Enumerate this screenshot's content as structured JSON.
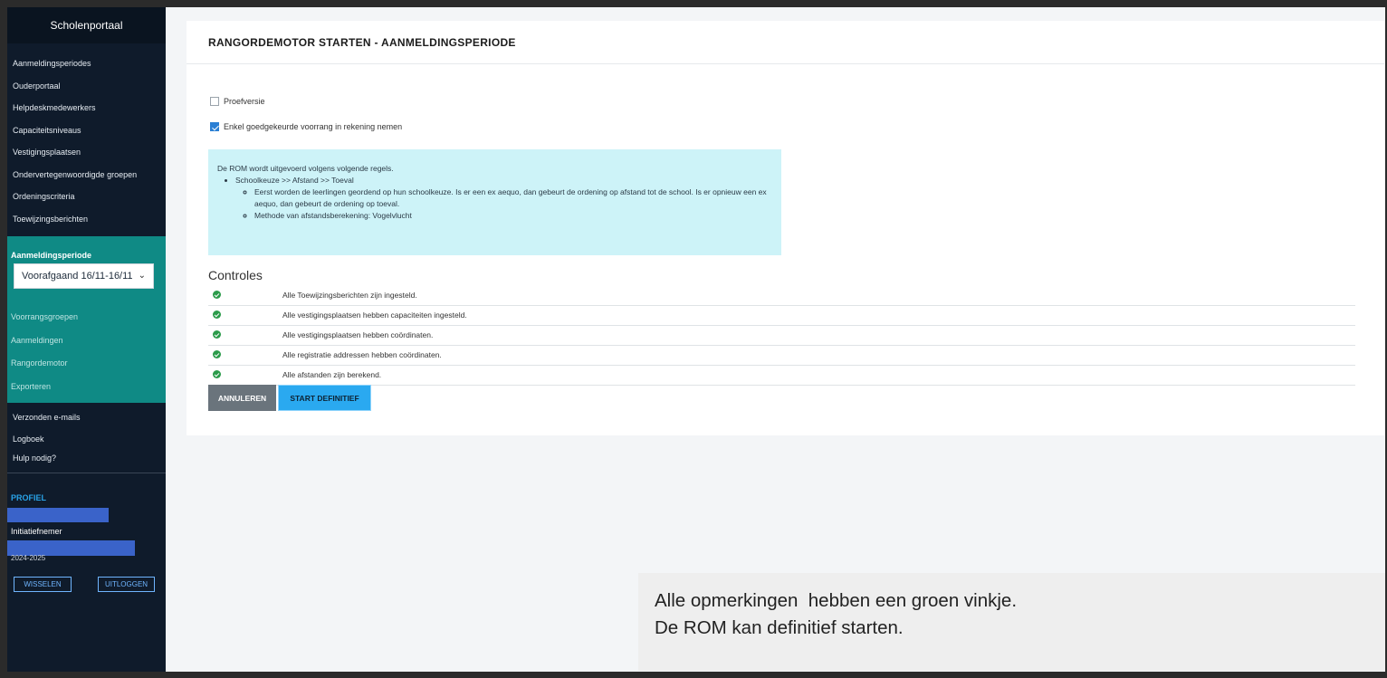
{
  "sidebar": {
    "brand": "Scholenportaal",
    "items": [
      {
        "label": "Aanmeldingsperiodes"
      },
      {
        "label": "Ouderportaal"
      },
      {
        "label": "Helpdeskmedewerkers"
      },
      {
        "label": "Capaciteitsniveaus"
      },
      {
        "label": "Vestigingsplaatsen"
      },
      {
        "label": "Ondervertegenwoordigde groepen"
      },
      {
        "label": "Ordeningscriteria"
      },
      {
        "label": "Toewijzingsberichten"
      }
    ],
    "period_section": {
      "title": "Aanmeldingsperiode",
      "selected": "Voorafgaand 16/11-16/11",
      "items": [
        {
          "label": "Voorrangsgroepen"
        },
        {
          "label": "Aanmeldingen"
        },
        {
          "label": "Rangordemotor"
        },
        {
          "label": "Exporteren"
        }
      ]
    },
    "lower_items": [
      {
        "label": "Verzonden e-mails"
      },
      {
        "label": "Logboek"
      },
      {
        "label": "Hulp nodig?"
      }
    ],
    "profile": {
      "title": "PROFIEL",
      "role": "Initiatiefnemer",
      "year": "2024-2025",
      "switch_label": "WISSELEN",
      "logout_label": "UITLOGGEN"
    }
  },
  "main": {
    "title": "RANGORDEMOTOR STARTEN - AANMELDINGSPERIODE",
    "checkboxes": [
      {
        "label": "Proefversie",
        "checked": false
      },
      {
        "label": "Enkel goedgekeurde voorrang in rekening nemen",
        "checked": true
      }
    ],
    "info": {
      "intro": "De ROM wordt uitgevoerd volgens volgende regels.",
      "rule": "Schoolkeuze >> Afstand >> Toeval",
      "sub1": "Eerst worden de leerlingen geordend op hun schoolkeuze. Is er een ex aequo, dan gebeurt de ordening op afstand tot de school. Is er opnieuw een ex aequo, dan gebeurt de ordening op toeval.",
      "sub2": "Methode van afstandsberekening: Vogelvlucht"
    },
    "controles_title": "Controles",
    "controles": [
      {
        "label": "Alle Toewijzingsberichten zijn ingesteld.",
        "status": "ok"
      },
      {
        "label": "Alle vestigingsplaatsen hebben capaciteiten ingesteld.",
        "status": "ok"
      },
      {
        "label": "Alle vestigingsplaatsen hebben coördinaten.",
        "status": "ok"
      },
      {
        "label": "Alle registratie addressen hebben coördinaten.",
        "status": "ok"
      },
      {
        "label": "Alle afstanden zijn berekend.",
        "status": "ok"
      }
    ],
    "cancel_label": "ANNULEREN",
    "start_label": "START DEFINITIEF"
  },
  "callout": {
    "line1": "Alle opmerkingen  hebben een groen vinkje.",
    "line2": "De ROM kan definitief starten."
  },
  "colors": {
    "sidebar_bg": "#0f1b2b",
    "teal": "#0f8a85",
    "ok_green": "#2b9b4a",
    "info_bg": "#cdf3f8",
    "start_blue": "#2aa9f0",
    "cancel_grey": "#6a747c"
  }
}
